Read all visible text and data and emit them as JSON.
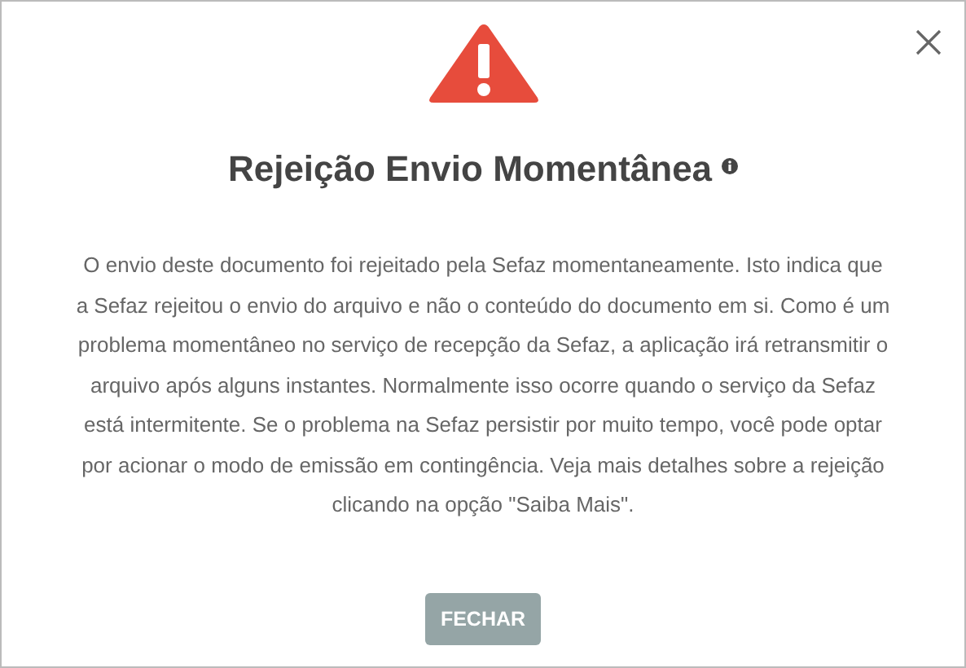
{
  "dialog": {
    "title": "Rejeição Envio Momentânea",
    "message": "O envio deste documento foi rejeitado pela Sefaz momentaneamente. Isto indica que a Sefaz rejeitou o envio do arquivo e não o conteúdo do documento em si. Como é um problema momentâneo no serviço de recepção da Sefaz, a aplicação irá retransmitir o arquivo após alguns instantes. Normalmente isso ocorre quando o serviço da Sefaz está intermitente. Se o problema na Sefaz persistir por muito tempo, você pode optar por acionar o modo de emissão em contingência. Veja mais detalhes sobre a rejeição clicando na opção \"Saiba Mais\".",
    "buttons": [
      "FECHAR"
    ]
  }
}
